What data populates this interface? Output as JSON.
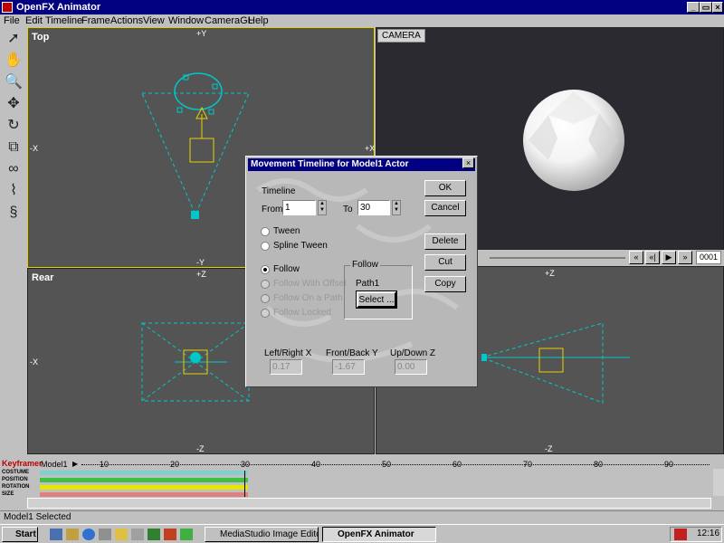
{
  "app": {
    "title": "OpenFX Animator"
  },
  "menu": [
    "File",
    "Edit",
    "Timeline",
    "Frame",
    "Actions",
    "View",
    "Window",
    "CameraGL",
    "Help"
  ],
  "viewports": {
    "top": {
      "label": "Top",
      "axis_top": "+Y",
      "axis_bottom": "-Y",
      "axis_left": "-X",
      "axis_right": "+X"
    },
    "camera": {
      "label": "CAMERA"
    },
    "rear": {
      "label": "Rear",
      "axis_top": "+Z",
      "axis_bottom": "-Z",
      "axis_left": "-X"
    },
    "side": {
      "axis_top": "+Z",
      "axis_bottom": "-Z"
    }
  },
  "camera_controls": {
    "frame": "0001",
    "buttons": [
      "«",
      "«|",
      "▶",
      "»"
    ]
  },
  "dialog": {
    "title": "Movement Timeline for Model1 Actor",
    "timeline_label": "Timeline",
    "from_label": "From",
    "from_value": "1",
    "to_label": "To",
    "to_value": "30",
    "options": {
      "tween": "Tween",
      "spline_tween": "Spline Tween",
      "follow": "Follow",
      "follow_with_offset": "Follow With Offset",
      "follow_on_path": "Follow On a Path",
      "follow_locked": "Follow Locked"
    },
    "follow_group": {
      "title": "Follow",
      "target": "Path1",
      "select_label": "Select ..."
    },
    "buttons": {
      "ok": "OK",
      "cancel": "Cancel",
      "delete": "Delete",
      "cut": "Cut",
      "copy": "Copy"
    },
    "coords": {
      "lr_label": "Left/Right X",
      "lr_value": "0.17",
      "fb_label": "Front/Back Y",
      "fb_value": "-1.67",
      "ud_label": "Up/Down Z",
      "ud_value": "0.00"
    }
  },
  "timeline": {
    "title": "Keyframer",
    "actor": "Model1",
    "ticks": [
      "10",
      "20",
      "30",
      "40",
      "50",
      "60",
      "70",
      "80",
      "90"
    ],
    "rows": [
      "COSTUME",
      "POSITION",
      "ROTATION",
      "SIZE"
    ]
  },
  "status": {
    "text": "Model1 Selected"
  },
  "taskbar": {
    "start": "Start",
    "tasks": [
      "MediaStudio Image Editor",
      "OpenFX Animator"
    ],
    "clock": "12:16"
  }
}
